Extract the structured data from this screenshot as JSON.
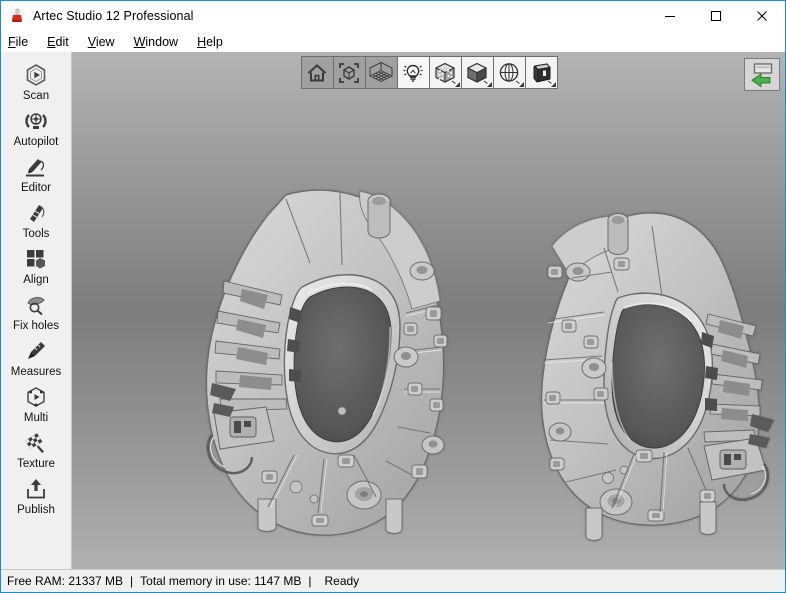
{
  "window": {
    "title": "Artec Studio 12 Professional",
    "app_icon": "artec-logo-icon",
    "controls": {
      "minimize": "minimize-icon",
      "maximize": "maximize-icon",
      "close": "close-icon"
    }
  },
  "menu": {
    "items": [
      {
        "mnemonic": "F",
        "rest": "ile"
      },
      {
        "mnemonic": "E",
        "rest": "dit"
      },
      {
        "mnemonic": "V",
        "rest": "iew"
      },
      {
        "mnemonic": "W",
        "rest": "indow"
      },
      {
        "mnemonic": "H",
        "rest": "elp"
      }
    ]
  },
  "sidebar": {
    "items": [
      {
        "label": "Scan",
        "icon": "scan-icon"
      },
      {
        "label": "Autopilot",
        "icon": "autopilot-icon"
      },
      {
        "label": "Editor",
        "icon": "editor-icon"
      },
      {
        "label": "Tools",
        "icon": "tools-icon"
      },
      {
        "label": "Align",
        "icon": "align-icon"
      },
      {
        "label": "Fix holes",
        "icon": "fix-holes-icon"
      },
      {
        "label": "Measures",
        "icon": "measures-icon"
      },
      {
        "label": "Multi",
        "icon": "multi-icon"
      },
      {
        "label": "Texture",
        "icon": "texture-icon"
      },
      {
        "label": "Publish",
        "icon": "publish-icon"
      }
    ]
  },
  "viewport": {
    "toolbar": [
      {
        "name": "home-view-button",
        "icon": "home-icon",
        "active": false,
        "caret": false
      },
      {
        "name": "fit-to-view-button",
        "icon": "fit-bounding-box-icon",
        "active": false,
        "caret": false
      },
      {
        "name": "toggle-grid-button",
        "icon": "grid-axes-icon",
        "active": false,
        "caret": false
      },
      {
        "name": "toggle-light-button",
        "icon": "light-bulb-icon",
        "active": true,
        "caret": false
      },
      {
        "name": "render-textured-button",
        "icon": "textured-cube-icon",
        "active": true,
        "caret": true
      },
      {
        "name": "render-shaded-button",
        "icon": "shaded-cube-icon",
        "active": true,
        "caret": true
      },
      {
        "name": "render-wireframe-button",
        "icon": "wireframe-sphere-icon",
        "active": true,
        "caret": true
      },
      {
        "name": "render-solid-button",
        "icon": "solid-cube-icon",
        "active": true,
        "caret": true
      }
    ],
    "panel_toggle": {
      "name": "collapse-panel-button",
      "icon": "green-left-arrow-icon"
    },
    "background_top": "#b4b4b4",
    "background_mid": "#7d7d7d",
    "models": [
      {
        "name": "scanned-mesh-left",
        "description": "3D scanned automotive structural panel, front-left view"
      },
      {
        "name": "scanned-mesh-right",
        "description": "3D scanned automotive structural panel, mirrored view"
      }
    ]
  },
  "status_bar": {
    "free_ram": "Free RAM: 21337 MB",
    "separator": "|",
    "memory_in_use": "Total memory in use: 1147 MB",
    "state": "Ready"
  }
}
